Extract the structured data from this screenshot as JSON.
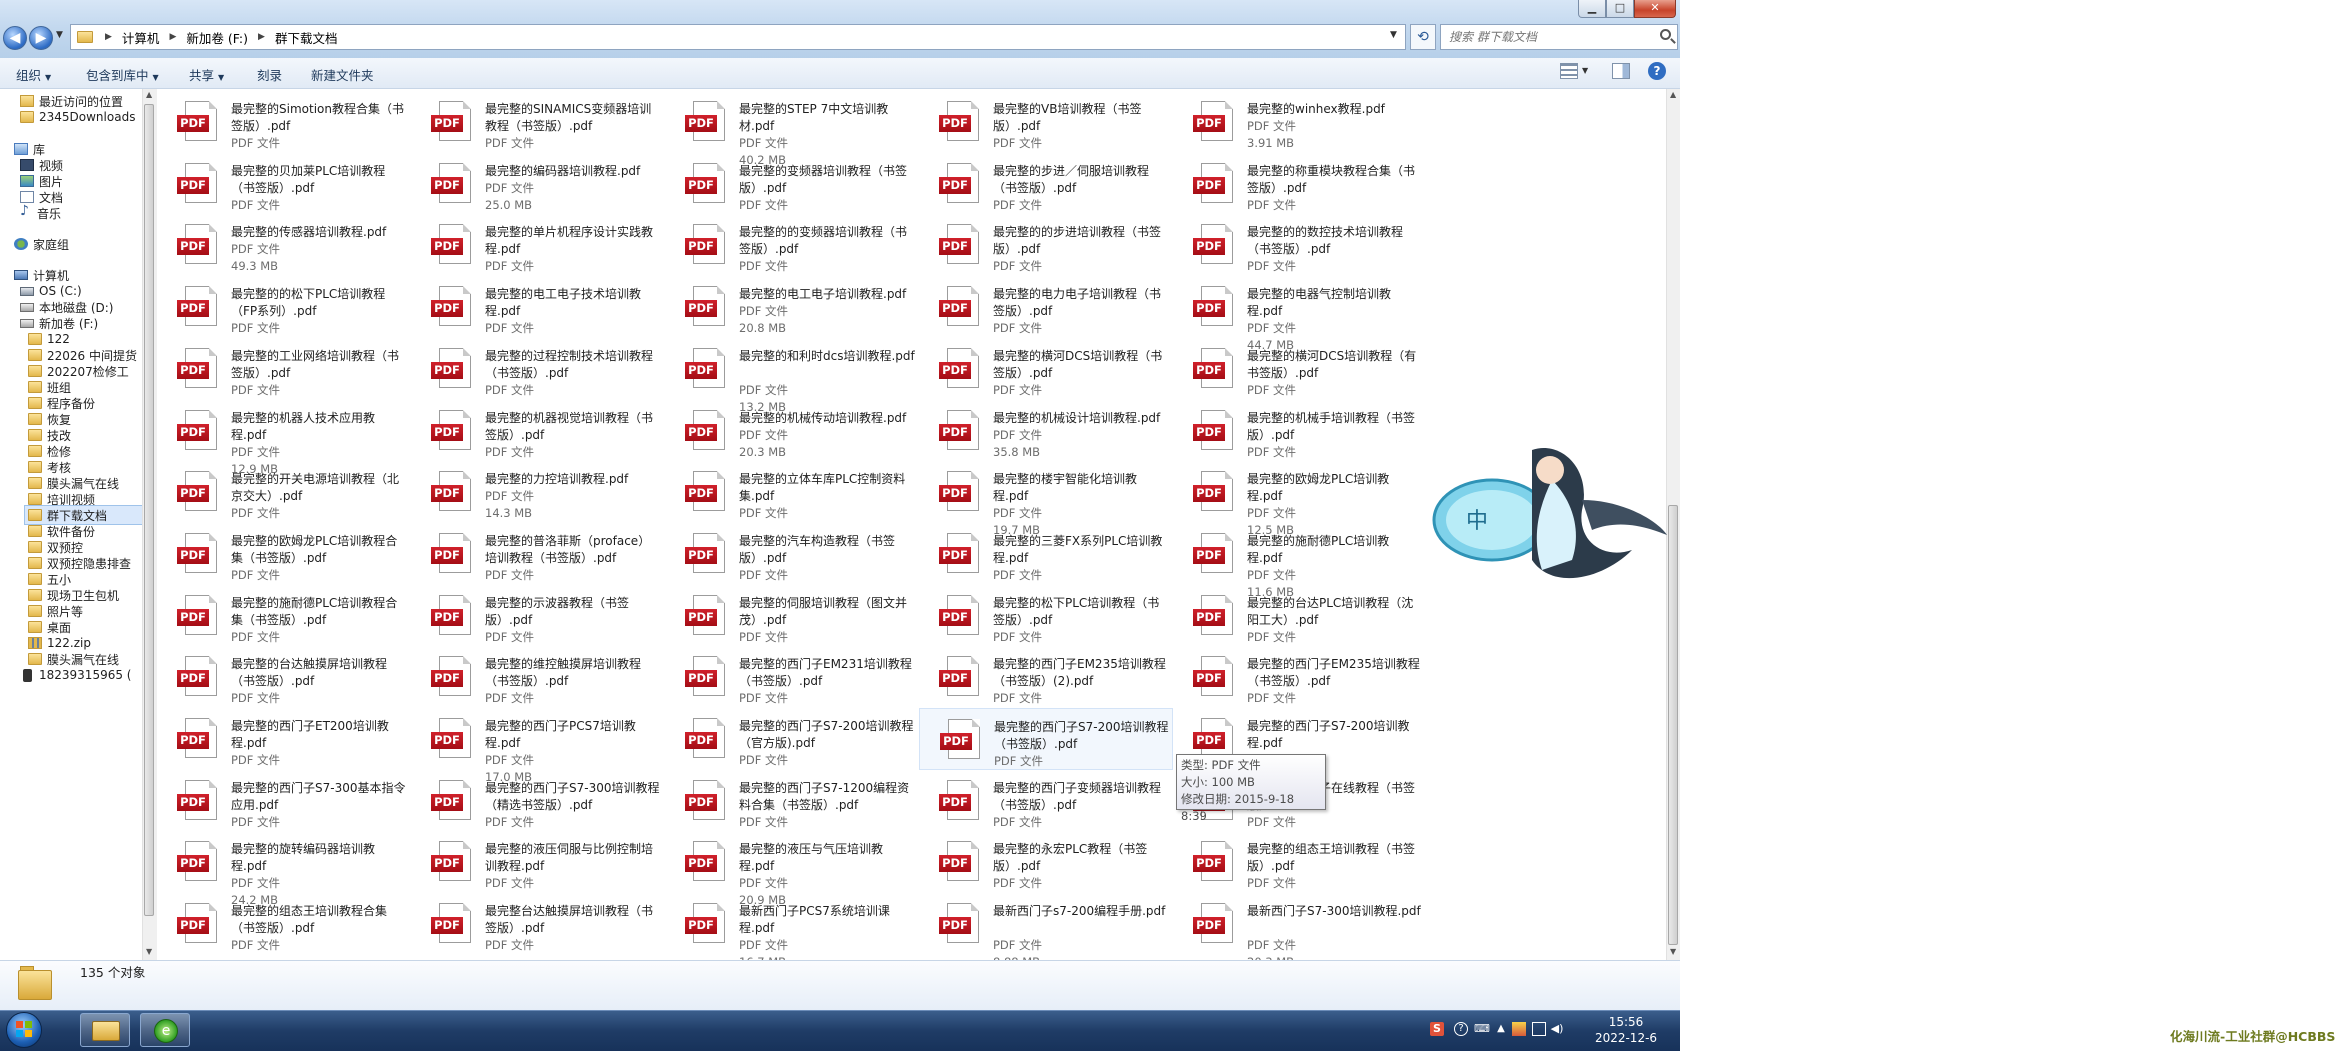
{
  "window": {
    "controls": {
      "minimize": "▁",
      "maximize": "□",
      "close": "✕"
    },
    "breadcrumbs": [
      "计算机",
      "新加卷 (F:)",
      "群下载文档"
    ],
    "search_placeholder": "搜索 群下载文档"
  },
  "toolbar": {
    "items": [
      "组织",
      "包含到库中",
      "共享",
      "刻录",
      "新建文件夹"
    ]
  },
  "nav": {
    "items": [
      {
        "label": "最近访问的位置",
        "icon": "recent-places-icon",
        "indent": 1
      },
      {
        "label": "2345Downloads",
        "icon": "folder-icon",
        "indent": 1
      },
      {
        "label": "库",
        "icon": "library-icon",
        "indent": 0
      },
      {
        "label": "视频",
        "icon": "video-icon",
        "indent": 1
      },
      {
        "label": "图片",
        "icon": "pictures-icon",
        "indent": 1
      },
      {
        "label": "文档",
        "icon": "documents-icon",
        "indent": 1
      },
      {
        "label": "音乐",
        "icon": "music-icon",
        "indent": 1
      },
      {
        "label": "家庭组",
        "icon": "homegroup-icon",
        "indent": 0
      },
      {
        "label": "计算机",
        "icon": "computer-icon",
        "indent": 0
      },
      {
        "label": "OS (C:)",
        "icon": "os-drive-icon",
        "indent": 1
      },
      {
        "label": "本地磁盘 (D:)",
        "icon": "drive-icon",
        "indent": 1
      },
      {
        "label": "新加卷 (F:)",
        "icon": "drive-icon",
        "indent": 1
      },
      {
        "label": "122",
        "icon": "folder-icon",
        "indent": 2
      },
      {
        "label": "22026 中间提货",
        "icon": "folder-icon",
        "indent": 2
      },
      {
        "label": "202207检修工",
        "icon": "folder-icon",
        "indent": 2
      },
      {
        "label": "班组",
        "icon": "folder-icon",
        "indent": 2
      },
      {
        "label": "程序备份",
        "icon": "folder-icon",
        "indent": 2
      },
      {
        "label": "恢复",
        "icon": "folder-icon",
        "indent": 2
      },
      {
        "label": "技改",
        "icon": "folder-icon",
        "indent": 2
      },
      {
        "label": "检修",
        "icon": "folder-icon",
        "indent": 2
      },
      {
        "label": "考核",
        "icon": "folder-icon",
        "indent": 2
      },
      {
        "label": "膜头漏气在线",
        "icon": "folder-icon",
        "indent": 2
      },
      {
        "label": "培训视频",
        "icon": "folder-icon",
        "indent": 2
      },
      {
        "label": "群下载文档",
        "icon": "folder-icon",
        "indent": 2,
        "selected": true
      },
      {
        "label": "软件备份",
        "icon": "folder-icon",
        "indent": 2
      },
      {
        "label": "双预控",
        "icon": "folder-icon",
        "indent": 2
      },
      {
        "label": "双预控隐患排查",
        "icon": "folder-icon",
        "indent": 2
      },
      {
        "label": "五小",
        "icon": "folder-icon",
        "indent": 2
      },
      {
        "label": "现场卫生包机",
        "icon": "folder-icon",
        "indent": 2
      },
      {
        "label": "照片等",
        "icon": "folder-icon",
        "indent": 2
      },
      {
        "label": "桌面",
        "icon": "folder-icon",
        "indent": 2
      },
      {
        "label": "122.zip",
        "icon": "zip-icon",
        "indent": 2
      },
      {
        "label": "膜头漏气在线",
        "icon": "folder-icon",
        "indent": 2
      },
      {
        "label": "18239315965 (",
        "icon": "phone-icon",
        "indent": 1
      }
    ]
  },
  "files": [
    {
      "name": "最完整的Simotion教程合集（书签版）.pdf",
      "type": "PDF 文件",
      "size": ""
    },
    {
      "name": "最完整的SINAMICS变频器培训教程（书签版）.pdf",
      "type": "PDF 文件",
      "size": ""
    },
    {
      "name": "最完整的STEP 7中文培训教材.pdf",
      "type": "PDF 文件",
      "size": "40.2 MB"
    },
    {
      "name": "最完整的VB培训教程（书签版）.pdf",
      "type": "PDF 文件",
      "size": ""
    },
    {
      "name": "最完整的winhex教程.pdf",
      "type": "PDF 文件",
      "size": "3.91 MB"
    },
    {
      "name": "最完整的贝加莱PLC培训教程（书签版）.pdf",
      "type": "PDF 文件",
      "size": ""
    },
    {
      "name": "最完整的编码器培训教程.pdf",
      "type": "PDF 文件",
      "size": "25.0 MB"
    },
    {
      "name": "最完整的变频器培训教程（书签版）.pdf",
      "type": "PDF 文件",
      "size": ""
    },
    {
      "name": "最完整的步进／伺服培训教程（书签版）.pdf",
      "type": "PDF 文件",
      "size": ""
    },
    {
      "name": "最完整的称重模块教程合集（书签版）.pdf",
      "type": "PDF 文件",
      "size": ""
    },
    {
      "name": "最完整的传感器培训教程.pdf",
      "type": "PDF 文件",
      "size": "49.3 MB"
    },
    {
      "name": "最完整的单片机程序设计实践教程.pdf",
      "type": "PDF 文件",
      "size": ""
    },
    {
      "name": "最完整的的变频器培训教程（书签版）.pdf",
      "type": "PDF 文件",
      "size": ""
    },
    {
      "name": "最完整的的步进培训教程（书签版）.pdf",
      "type": "PDF 文件",
      "size": ""
    },
    {
      "name": "最完整的的数控技术培训教程（书签版）.pdf",
      "type": "PDF 文件",
      "size": ""
    },
    {
      "name": "最完整的的松下PLC培训教程（FP系列）.pdf",
      "type": "PDF 文件",
      "size": ""
    },
    {
      "name": "最完整的电工电子技术培训教程.pdf",
      "type": "PDF 文件",
      "size": ""
    },
    {
      "name": "最完整的电工电子培训教程.pdf",
      "type": "PDF 文件",
      "size": "20.8 MB"
    },
    {
      "name": "最完整的电力电子培训教程（书签版）.pdf",
      "type": "PDF 文件",
      "size": ""
    },
    {
      "name": "最完整的电器气控制培训教程.pdf",
      "type": "PDF 文件",
      "size": "44.7 MB"
    },
    {
      "name": "最完整的工业网络培训教程（书签版）.pdf",
      "type": "PDF 文件",
      "size": ""
    },
    {
      "name": "最完整的过程控制技术培训教程（书签版）.pdf",
      "type": "PDF 文件",
      "size": ""
    },
    {
      "name": "最完整的和利时dcs培训教程.pdf",
      "type": "PDF 文件",
      "size": "13.2 MB"
    },
    {
      "name": "最完整的横河DCS培训教程（书签版）.pdf",
      "type": "PDF 文件",
      "size": ""
    },
    {
      "name": "最完整的横河DCS培训教程（有书签版）.pdf",
      "type": "PDF 文件",
      "size": ""
    },
    {
      "name": "最完整的机器人技术应用教程.pdf",
      "type": "PDF 文件",
      "size": "12.9 MB"
    },
    {
      "name": "最完整的机器视觉培训教程（书签版）.pdf",
      "type": "PDF 文件",
      "size": ""
    },
    {
      "name": "最完整的机械传动培训教程.pdf",
      "type": "PDF 文件",
      "size": "20.3 MB"
    },
    {
      "name": "最完整的机械设计培训教程.pdf",
      "type": "PDF 文件",
      "size": "35.8 MB"
    },
    {
      "name": "最完整的机械手培训教程（书签版）.pdf",
      "type": "PDF 文件",
      "size": ""
    },
    {
      "name": "最完整的开关电源培训教程（北京交大）.pdf",
      "type": "PDF 文件",
      "size": ""
    },
    {
      "name": "最完整的力控培训教程.pdf",
      "type": "PDF 文件",
      "size": "14.3 MB"
    },
    {
      "name": "最完整的立体车库PLC控制资料集.pdf",
      "type": "PDF 文件",
      "size": ""
    },
    {
      "name": "最完整的楼宇智能化培训教程.pdf",
      "type": "PDF 文件",
      "size": "19.7 MB"
    },
    {
      "name": "最完整的欧姆龙PLC培训教程.pdf",
      "type": "PDF 文件",
      "size": "12.5 MB"
    },
    {
      "name": "最完整的欧姆龙PLC培训教程合集（书签版）.pdf",
      "type": "PDF 文件",
      "size": ""
    },
    {
      "name": "最完整的普洛菲斯（proface）培训教程（书签版）.pdf",
      "type": "PDF 文件",
      "size": ""
    },
    {
      "name": "最完整的汽车构造教程（书签版）.pdf",
      "type": "PDF 文件",
      "size": ""
    },
    {
      "name": "最完整的三菱FX系列PLC培训教程.pdf",
      "type": "PDF 文件",
      "size": ""
    },
    {
      "name": "最完整的施耐德PLC培训教程.pdf",
      "type": "PDF 文件",
      "size": "11.6 MB"
    },
    {
      "name": "最完整的施耐德PLC培训教程合集（书签版）.pdf",
      "type": "PDF 文件",
      "size": ""
    },
    {
      "name": "最完整的示波器教程（书签版）.pdf",
      "type": "PDF 文件",
      "size": ""
    },
    {
      "name": "最完整的伺服培训教程（图文并茂）.pdf",
      "type": "PDF 文件",
      "size": ""
    },
    {
      "name": "最完整的松下PLC培训教程（书签版）.pdf",
      "type": "PDF 文件",
      "size": ""
    },
    {
      "name": "最完整的台达PLC培训教程（沈阳工大）.pdf",
      "type": "PDF 文件",
      "size": ""
    },
    {
      "name": "最完整的台达触摸屏培训教程（书签版）.pdf",
      "type": "PDF 文件",
      "size": ""
    },
    {
      "name": "最完整的维控触摸屏培训教程（书签版）.pdf",
      "type": "PDF 文件",
      "size": ""
    },
    {
      "name": "最完整的西门子EM231培训教程（书签版）.pdf",
      "type": "PDF 文件",
      "size": ""
    },
    {
      "name": "最完整的西门子EM235培训教程（书签版）(2).pdf",
      "type": "PDF 文件",
      "size": ""
    },
    {
      "name": "最完整的西门子EM235培训教程（书签版）.pdf",
      "type": "PDF 文件",
      "size": ""
    },
    {
      "name": "最完整的西门子ET200培训教程.pdf",
      "type": "PDF 文件",
      "size": ""
    },
    {
      "name": "最完整的西门子PCS7培训教程.pdf",
      "type": "PDF 文件",
      "size": "17.0 MB"
    },
    {
      "name": "最完整的西门子S7-200培训教程（官方版).pdf",
      "type": "PDF 文件",
      "size": ""
    },
    {
      "name": "最完整的西门子S7-200培训教程（书签版）.pdf",
      "type": "PDF 文件",
      "size": "",
      "hover": true
    },
    {
      "name": "最完整的西门子S7-200培训教程.pdf",
      "type": "PDF 文件",
      "size": ""
    },
    {
      "name": "最完整的西门子S7-300基本指令应用.pdf",
      "type": "PDF 文件",
      "size": ""
    },
    {
      "name": "最完整的西门子S7-300培训教程（精选书签版）.pdf",
      "type": "PDF 文件",
      "size": ""
    },
    {
      "name": "最完整的西门子S7-1200编程资料合集（书签版）.pdf",
      "type": "PDF 文件",
      "size": ""
    },
    {
      "name": "最完整的西门子变频器培训教程（书签版）.pdf",
      "type": "PDF 文件",
      "size": ""
    },
    {
      "name": "最完整的西门子在线教程（书签版）",
      "type": "PDF 文件",
      "size": ""
    },
    {
      "name": "最完整的旋转编码器培训教程.pdf",
      "type": "PDF 文件",
      "size": "24.2 MB"
    },
    {
      "name": "最完整的液压伺服与比例控制培训教程.pdf",
      "type": "PDF 文件",
      "size": ""
    },
    {
      "name": "最完整的液压与气压培训教程.pdf",
      "type": "PDF 文件",
      "size": "20.9 MB"
    },
    {
      "name": "最完整的永宏PLC教程（书签版）.pdf",
      "type": "PDF 文件",
      "size": ""
    },
    {
      "name": "最完整的组态王培训教程（书签版）.pdf",
      "type": "PDF 文件",
      "size": ""
    },
    {
      "name": "最完整的组态王培训教程合集（书签版）.pdf",
      "type": "PDF 文件",
      "size": ""
    },
    {
      "name": "最完整台达触摸屏培训教程（书签版）.pdf",
      "type": "PDF 文件",
      "size": ""
    },
    {
      "name": "最新西门子PCS7系统培训课程.pdf",
      "type": "PDF 文件",
      "size": "16.7 MB"
    },
    {
      "name": "最新西门子s7-200编程手册.pdf",
      "type": "PDF 文件",
      "size": "8.88 MB"
    },
    {
      "name": "最新西门子S7-300培训教程.pdf",
      "type": "PDF 文件",
      "size": "20.3 MB"
    }
  ],
  "pdf_badge": "PDF",
  "tooltip": {
    "type_line": "类型: PDF 文件",
    "size_line": "大小: 100 MB",
    "date_line": "修改日期: 2015-9-18 8:39"
  },
  "details": {
    "count": "135 个对象"
  },
  "taskbar": {
    "time": "15:56",
    "date": "2022-12-6"
  },
  "watermark": "化海川流-工业社群@HCBBS",
  "colors": {
    "pdf_red": "#c4151e",
    "taskbar": "#1f3c66",
    "selection": "#d9e8fb"
  }
}
